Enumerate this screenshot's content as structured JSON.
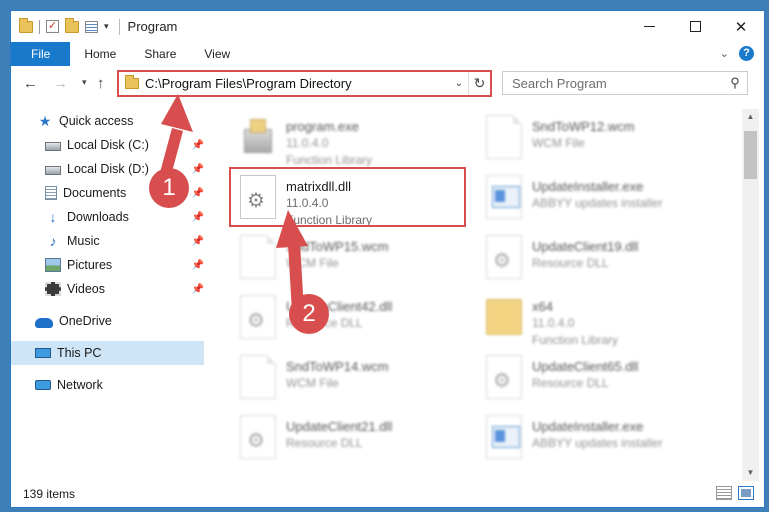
{
  "window": {
    "title": "Program",
    "controls": {
      "minimize": "",
      "maximize": "",
      "close": "✕"
    }
  },
  "quick_access_toolbar": {
    "icons": [
      "folder-icon",
      "properties-checkmark-icon",
      "new-folder-icon",
      "properties-icon",
      "customize-dropdown-icon"
    ]
  },
  "ribbon": {
    "tabs": [
      "File",
      "Home",
      "Share",
      "View"
    ],
    "collapse_glyph": "⌄",
    "help_glyph": "?"
  },
  "navigation": {
    "back_glyph": "←",
    "forward_glyph": "→",
    "recent_glyph": "▾",
    "up_glyph": "↑",
    "address": "C:\\Program Files\\Program Directory",
    "address_dropdown_glyph": "⌄",
    "refresh_glyph": "↻",
    "search_placeholder": "Search Program",
    "search_glyph": "⚲"
  },
  "sidebar": {
    "items": [
      {
        "label": "Quick access",
        "icon": "star-icon",
        "pinned": false
      },
      {
        "label": "Local Disk (C:)",
        "icon": "disk-icon",
        "pinned": true
      },
      {
        "label": "Local Disk (D:)",
        "icon": "disk-icon",
        "pinned": true
      },
      {
        "label": "Documents",
        "icon": "documents-icon",
        "pinned": true
      },
      {
        "label": "Downloads",
        "icon": "downloads-icon",
        "pinned": true
      },
      {
        "label": "Music",
        "icon": "music-icon",
        "pinned": true
      },
      {
        "label": "Pictures",
        "icon": "pictures-icon",
        "pinned": true
      },
      {
        "label": "Videos",
        "icon": "videos-icon",
        "pinned": true
      },
      {
        "label": "OneDrive",
        "icon": "onedrive-icon",
        "pinned": false
      },
      {
        "label": "This PC",
        "icon": "this-pc-icon",
        "pinned": false,
        "selected": true
      },
      {
        "label": "Network",
        "icon": "network-icon",
        "pinned": false
      }
    ],
    "pin_glyph": "📌"
  },
  "files": [
    {
      "name": "program.exe",
      "detail": "11.0.4.0",
      "type": "Function Library",
      "icon": "app-icon"
    },
    {
      "name": "SndToWP12.wcm",
      "detail": "WCM File",
      "type": "",
      "icon": "document-icon"
    },
    {
      "name": "matrixdll.dll",
      "detail": "11.0.4.0",
      "type": "Function Library",
      "icon": "gear-file-icon",
      "highlighted": true
    },
    {
      "name": "UpdateInstaller.exe",
      "detail": "ABBYY updates installer",
      "type": "",
      "icon": "installer-icon"
    },
    {
      "name": "SndToWP15.wcm",
      "detail": "WCM File",
      "type": "",
      "icon": "document-icon"
    },
    {
      "name": "UpdateClient19.dll",
      "detail": "Resource DLL",
      "type": "",
      "icon": "gear-file-icon"
    },
    {
      "name": "UpdateClient42.dll",
      "detail": "Resource DLL",
      "type": "",
      "icon": "gear-file-icon"
    },
    {
      "name": "x64",
      "detail": "11.0.4.0",
      "type": "Function Library",
      "icon": "folder-icon"
    },
    {
      "name": "SndToWP14.wcm",
      "detail": "WCM File",
      "type": "",
      "icon": "document-icon"
    },
    {
      "name": "UpdateClient65.dll",
      "detail": "Resource DLL",
      "type": "",
      "icon": "gear-file-icon"
    },
    {
      "name": "UpdateClient21.dll",
      "detail": "Resource DLL",
      "type": "",
      "icon": "gear-file-icon"
    },
    {
      "name": "UpdateInstaller.exe",
      "detail": "ABBYY updates installer",
      "type": "",
      "icon": "installer-icon"
    }
  ],
  "status": {
    "item_count": "139 items"
  },
  "annotations": {
    "marker_1": "1",
    "marker_2": "2",
    "color": "#d84d4d"
  },
  "colors": {
    "accent": "#1979ca",
    "selection": "#cde5f7",
    "annotation": "#d84d4d"
  }
}
